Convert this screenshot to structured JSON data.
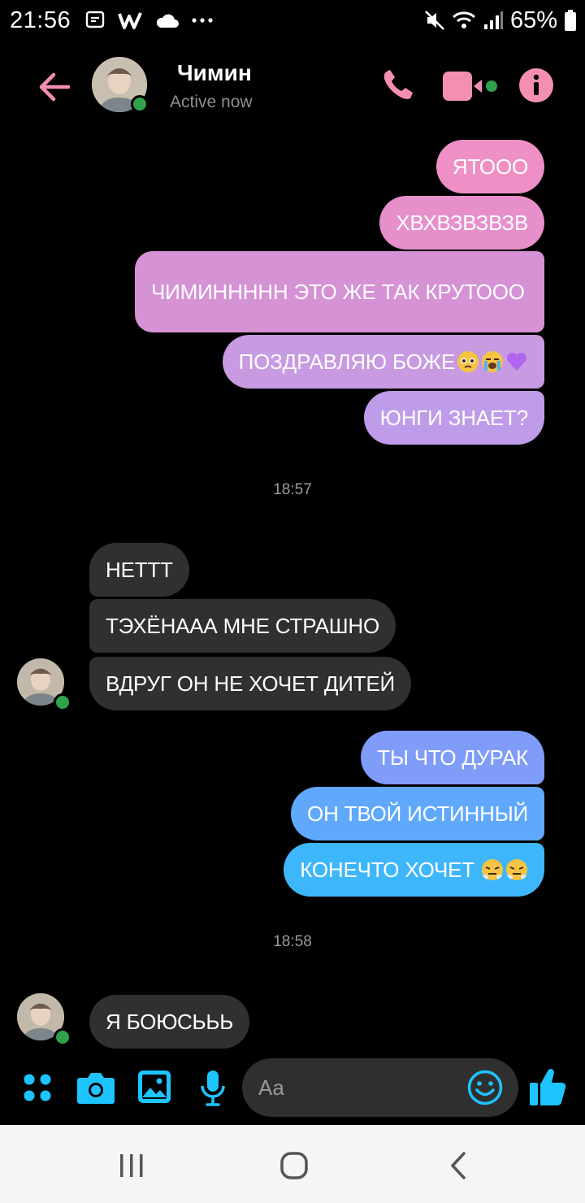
{
  "status_bar": {
    "time": "21:56",
    "battery": "65%",
    "icons": [
      "messenger-notification-icon",
      "w-app-icon",
      "cloud-icon",
      "more-dots-icon",
      "mute-icon",
      "wifi-icon",
      "signal-icon",
      "battery-icon"
    ]
  },
  "header": {
    "name": "Чимин",
    "status": "Active now",
    "accent_color": "#f48fb1",
    "online_color": "#31a24c"
  },
  "messages": [
    {
      "id": "o1",
      "text": "ЯТООО",
      "sender": "me"
    },
    {
      "id": "o2",
      "text": "ХВХВЗВЗВЗВ",
      "sender": "me"
    },
    {
      "id": "o3",
      "text": "ЧИМИННННН ЭТО ЖЕ ТАК КРУТООО",
      "sender": "me"
    },
    {
      "id": "o4",
      "text": "ПОЗДРАВЛЯЮ БОЖЕ",
      "sender": "me",
      "emojis": [
        "pleading-face",
        "loudly-crying-face",
        "purple-heart"
      ]
    },
    {
      "id": "o5",
      "text": "ЮНГИ ЗНАЕТ?",
      "sender": "me"
    },
    {
      "id": "t1",
      "timestamp": "18:57"
    },
    {
      "id": "i1",
      "text": "НЕТТТ",
      "sender": "them"
    },
    {
      "id": "i2",
      "text": "ТЭХЁНААА МНЕ СТРАШНО",
      "sender": "them"
    },
    {
      "id": "i3",
      "text": "ВДРУГ ОН НЕ ХОЧЕТ ДИТЕЙ",
      "sender": "them"
    },
    {
      "id": "o6",
      "text": "ТЫ ЧТО ДУРАК",
      "sender": "me"
    },
    {
      "id": "o7",
      "text": "ОН ТВОЙ ИСТИННЫЙ",
      "sender": "me"
    },
    {
      "id": "o8",
      "text": "КОНЕЧТО ХОЧЕТ",
      "sender": "me",
      "emojis": [
        "face-with-steam",
        "face-with-steam"
      ]
    },
    {
      "id": "t2",
      "timestamp": "18:58"
    },
    {
      "id": "i4",
      "text": "Я БОЮСЬЬЬ",
      "sender": "them"
    }
  ],
  "composer": {
    "placeholder": "Aa",
    "icon_color": "#1ec4ff",
    "icons": [
      "apps-grid-icon",
      "camera-icon",
      "gallery-icon",
      "microphone-icon",
      "emoji-icon",
      "thumbs-up-icon"
    ]
  },
  "nav_bar": {
    "icons": [
      "recent-apps-icon",
      "home-icon",
      "back-icon"
    ]
  }
}
